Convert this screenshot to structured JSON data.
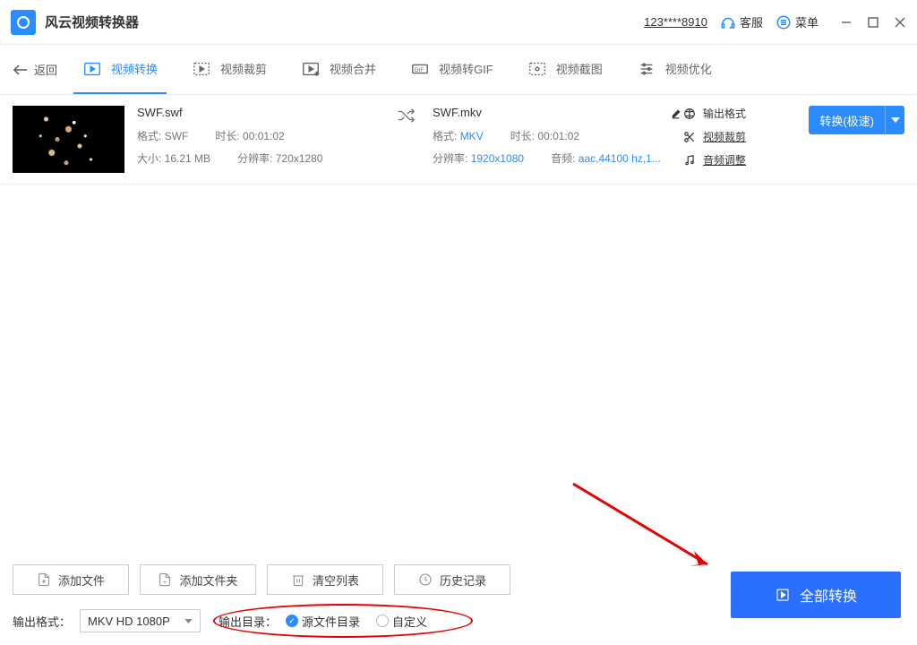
{
  "titlebar": {
    "app_name": "风云视频转换器",
    "user_id": "123****8910",
    "support_label": "客服",
    "menu_label": "菜单"
  },
  "tabs": {
    "back": "返回",
    "items": [
      {
        "label": "视频转换"
      },
      {
        "label": "视频裁剪"
      },
      {
        "label": "视频合并"
      },
      {
        "label": "视频转GIF"
      },
      {
        "label": "视频截图"
      },
      {
        "label": "视频优化"
      }
    ]
  },
  "file": {
    "src": {
      "name": "SWF.swf",
      "format_label": "格式:",
      "format": "SWF",
      "duration_label": "时长:",
      "duration": "00:01:02",
      "size_label": "大小:",
      "size": "16.21 MB",
      "resolution_label": "分辨率:",
      "resolution": "720x1280"
    },
    "dst": {
      "name": "SWF.mkv",
      "format_label": "格式:",
      "format": "MKV",
      "duration_label": "时长:",
      "duration": "00:01:02",
      "resolution_label": "分辨率:",
      "resolution": "1920x1080",
      "audio_label": "音频:",
      "audio": "aac,44100 hz,1..."
    },
    "actions": {
      "output_format": "输出格式",
      "crop": "视频裁剪",
      "audio_adjust": "音频调整"
    },
    "convert_label": "转换(极速)"
  },
  "bottom": {
    "add_file": "添加文件",
    "add_folder": "添加文件夹",
    "clear_list": "清空列表",
    "history": "历史记录",
    "output_format_label": "输出格式：",
    "output_format_value": "MKV HD 1080P",
    "output_dir_label": "输出目录：",
    "radio_source": "源文件目录",
    "radio_custom": "自定义",
    "convert_all": "全部转换"
  }
}
